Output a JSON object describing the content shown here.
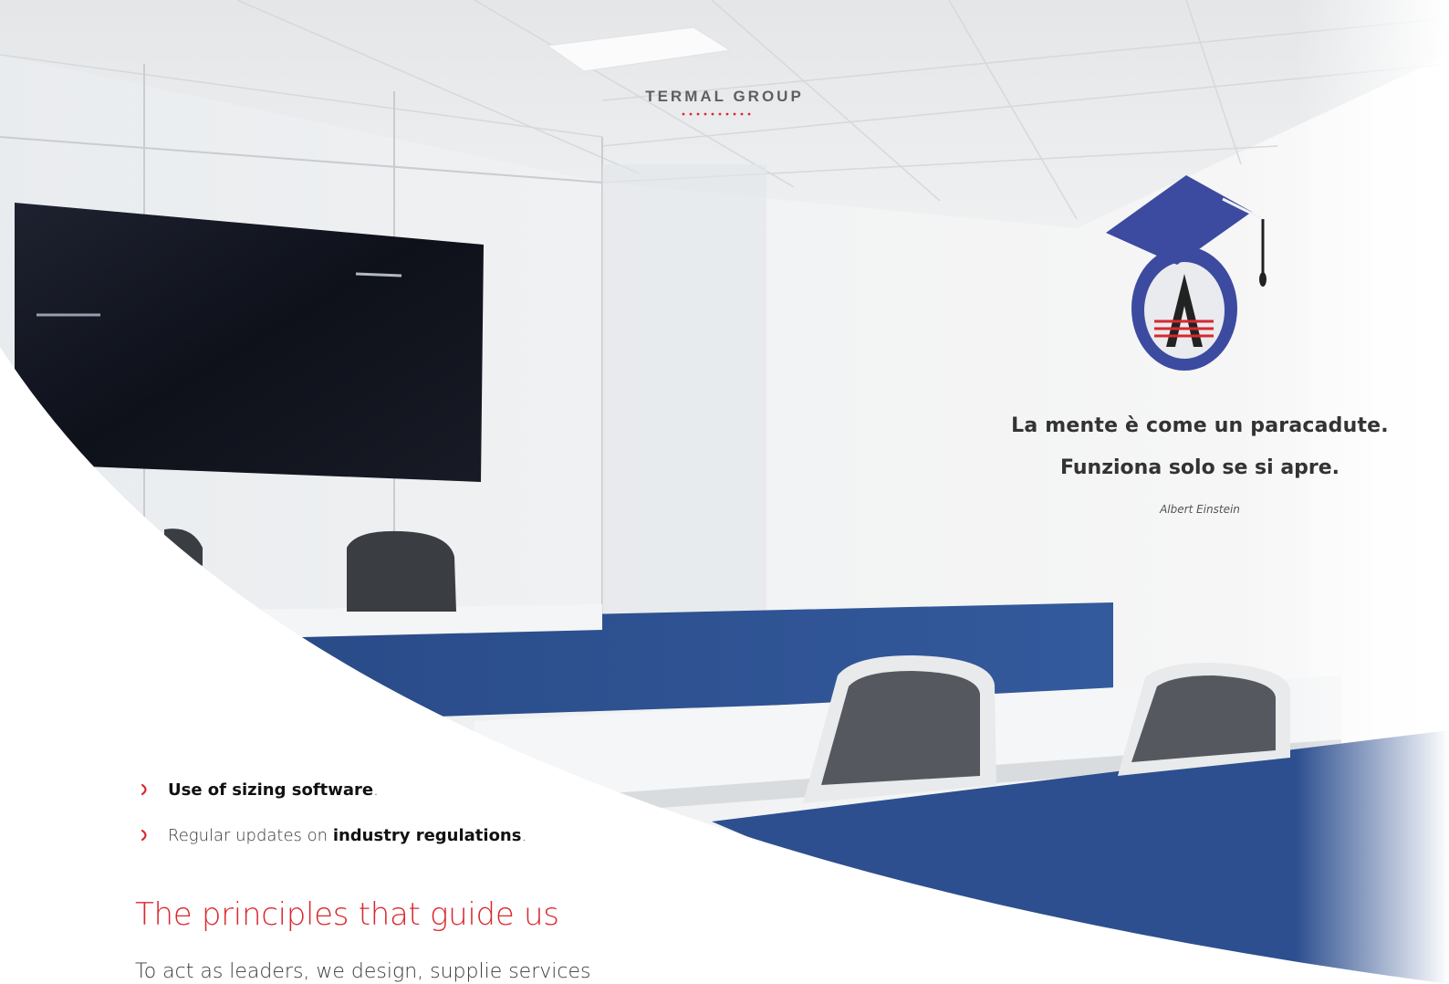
{
  "header": {
    "brand": "TERMAL GROUP",
    "accent_color": "#d9282f"
  },
  "wall_quote": {
    "line1": "La mente è come un paracadute.",
    "line2": "Funziona solo se si apre.",
    "author": "Albert Einstein"
  },
  "bullets": [
    {
      "bold": "Use of sizing software",
      "tail": "."
    },
    {
      "prefix": "Regular updates on ",
      "bold": "industry regulations",
      "tail": "."
    }
  ],
  "section": {
    "heading": "The principles that guide us",
    "paragraph_start": "To act as leaders, we design, supplie services"
  },
  "icons": {
    "bullet": "chevron-right-icon",
    "wall_logo": "graduation-cap-logo"
  },
  "colors": {
    "accent": "#d9282f",
    "desk_blue": "#2d4f8f",
    "logo_blue": "#3c4ba0"
  }
}
